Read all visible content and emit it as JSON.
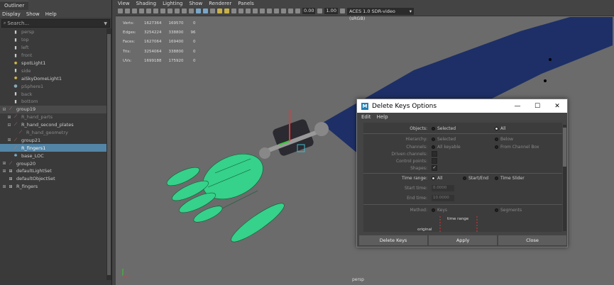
{
  "outliner": {
    "tab": "Outliner",
    "menu": [
      "Display",
      "Show",
      "Help"
    ],
    "search_placeholder": "Search...",
    "items": [
      {
        "label": "persp",
        "icon": "camera-icon",
        "dim": true,
        "indent": 1
      },
      {
        "label": "top",
        "icon": "camera-icon",
        "dim": true,
        "indent": 1
      },
      {
        "label": "left",
        "icon": "camera-icon",
        "dim": true,
        "indent": 1
      },
      {
        "label": "front",
        "icon": "camera-icon",
        "dim": true,
        "indent": 1
      },
      {
        "label": "spotLight1",
        "icon": "light-icon",
        "dim": false,
        "indent": 1
      },
      {
        "label": "side",
        "icon": "camera-icon",
        "dim": true,
        "indent": 1
      },
      {
        "label": "aiSkyDomeLight1",
        "icon": "light-icon",
        "dim": false,
        "indent": 1
      },
      {
        "label": "pSphere1",
        "icon": "sphere-icon",
        "dim": true,
        "indent": 1
      },
      {
        "label": "back",
        "icon": "camera-icon",
        "dim": true,
        "indent": 1
      },
      {
        "label": "bottom",
        "icon": "camera-icon",
        "dim": true,
        "indent": 1
      },
      {
        "label": "group19",
        "icon": "group-icon",
        "dim": false,
        "indent": 0,
        "expander": "−",
        "group": true
      },
      {
        "label": "R_hand_parts",
        "icon": "group-icon",
        "dim": true,
        "indent": 1,
        "expander": "+"
      },
      {
        "label": "R_hand_second_plates",
        "icon": "group-icon",
        "dim": false,
        "indent": 1,
        "expander": "−"
      },
      {
        "label": "R_hand_geometry",
        "icon": "mesh-icon",
        "dim": true,
        "indent": 2
      },
      {
        "label": "group21",
        "icon": "group-icon",
        "dim": false,
        "indent": 1,
        "expander": "+"
      },
      {
        "label": "R_fingers1",
        "icon": "group-icon",
        "dim": false,
        "indent": 1,
        "selected": true
      },
      {
        "label": "base_LOC",
        "icon": "locator-icon",
        "dim": false,
        "indent": 1
      },
      {
        "label": "group20",
        "icon": "group-icon",
        "dim": false,
        "indent": 0,
        "expander": "+"
      },
      {
        "label": "defaultLightSet",
        "icon": "set-icon",
        "dim": false,
        "indent": 0,
        "expander": "+"
      },
      {
        "label": "defaultObjectSet",
        "icon": "set-icon",
        "dim": false,
        "indent": 0
      },
      {
        "label": "R_fingers",
        "icon": "set-icon",
        "dim": false,
        "indent": 0,
        "expander": "+"
      }
    ]
  },
  "viewport": {
    "menu": [
      "View",
      "Shading",
      "Lighting",
      "Show",
      "Renderer",
      "Panels"
    ],
    "exposure": "0.00",
    "gamma": "1.00",
    "colorspace": "ACES 1.0 SDR-video (sRGB)",
    "camera_label": "persp",
    "hud": [
      {
        "label": "Verts:",
        "a": "1627364",
        "b": "169570",
        "c": "0"
      },
      {
        "label": "Edges:",
        "a": "3254224",
        "b": "338800",
        "c": "96"
      },
      {
        "label": "Faces:",
        "a": "1627064",
        "b": "169400",
        "c": "0"
      },
      {
        "label": "Tris:",
        "a": "3254064",
        "b": "338800",
        "c": "0"
      },
      {
        "label": "UVs:",
        "a": "1699188",
        "b": "175920",
        "c": "0"
      }
    ]
  },
  "dialog": {
    "title": "Delete Keys Options",
    "menu": [
      "Edit",
      "Help"
    ],
    "objects_label": "Objects:",
    "objects_opt1": "Selected",
    "objects_opt2": "All",
    "hierarchy_label": "Hierarchy:",
    "hierarchy_opt1": "Selected",
    "hierarchy_opt2": "Below",
    "channels_label": "Channels:",
    "channels_opt1": "All keyable",
    "channels_opt2": "From Channel Box",
    "driven_label": "Driven channels:",
    "control_label": "Control points:",
    "shapes_label": "Shapes:",
    "timerange_label": "Time range:",
    "timerange_opt1": "All",
    "timerange_opt2": "Start/End",
    "timerange_opt3": "Time Slider",
    "start_label": "Start time:",
    "start_value": "0.0000",
    "end_label": "End time:",
    "end_value": "10.0000",
    "method_label": "Method:",
    "method_opt1": "Keys",
    "method_opt2": "Segments",
    "diagram_label1": "time range",
    "diagram_label2": "original",
    "buttons": {
      "delete": "Delete Keys",
      "apply": "Apply",
      "close": "Close"
    }
  }
}
